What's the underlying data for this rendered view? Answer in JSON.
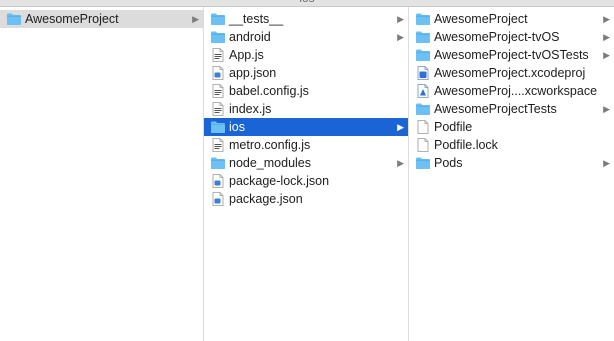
{
  "window": {
    "title": "ios"
  },
  "columns": [
    {
      "items": [
        {
          "label": "AwesomeProject",
          "icon": "folder-icon",
          "type": "folder",
          "has_children": true,
          "selected": "inactive"
        }
      ]
    },
    {
      "items": [
        {
          "label": "__tests__",
          "icon": "folder-icon",
          "type": "folder",
          "has_children": true
        },
        {
          "label": "android",
          "icon": "folder-icon",
          "type": "folder",
          "has_children": true
        },
        {
          "label": "App.js",
          "icon": "js-file-icon",
          "type": "file"
        },
        {
          "label": "app.json",
          "icon": "json-file-icon",
          "type": "file"
        },
        {
          "label": "babel.config.js",
          "icon": "js-file-icon",
          "type": "file"
        },
        {
          "label": "index.js",
          "icon": "js-file-icon",
          "type": "file"
        },
        {
          "label": "ios",
          "icon": "folder-icon",
          "type": "folder",
          "has_children": true,
          "selected": "active"
        },
        {
          "label": "metro.config.js",
          "icon": "js-file-icon",
          "type": "file"
        },
        {
          "label": "node_modules",
          "icon": "folder-icon",
          "type": "folder",
          "has_children": true
        },
        {
          "label": "package-lock.json",
          "icon": "json-file-icon",
          "type": "file"
        },
        {
          "label": "package.json",
          "icon": "json-file-icon",
          "type": "file"
        }
      ]
    },
    {
      "items": [
        {
          "label": "AwesomeProject",
          "icon": "folder-icon",
          "type": "folder",
          "has_children": true
        },
        {
          "label": "AwesomeProject-tvOS",
          "icon": "folder-icon",
          "type": "folder",
          "has_children": true
        },
        {
          "label": "AwesomeProject-tvOSTests",
          "icon": "folder-icon",
          "type": "folder",
          "has_children": true
        },
        {
          "label": "AwesomeProject.xcodeproj",
          "icon": "xcodeproj-icon",
          "type": "file"
        },
        {
          "label": "AwesomeProj....xcworkspace",
          "icon": "xcworkspace-icon",
          "type": "file"
        },
        {
          "label": "AwesomeProjectTests",
          "icon": "folder-icon",
          "type": "folder",
          "has_children": true
        },
        {
          "label": "Podfile",
          "icon": "blank-file-icon",
          "type": "file"
        },
        {
          "label": "Podfile.lock",
          "icon": "blank-file-icon",
          "type": "file"
        },
        {
          "label": "Pods",
          "icon": "folder-icon",
          "type": "folder",
          "has_children": true
        }
      ]
    }
  ],
  "colors": {
    "folder": "#6cc0f3",
    "folder_tab": "#4aa9e6",
    "selection_active": "#1a64d6",
    "selection_inactive": "#dcdcdc"
  }
}
